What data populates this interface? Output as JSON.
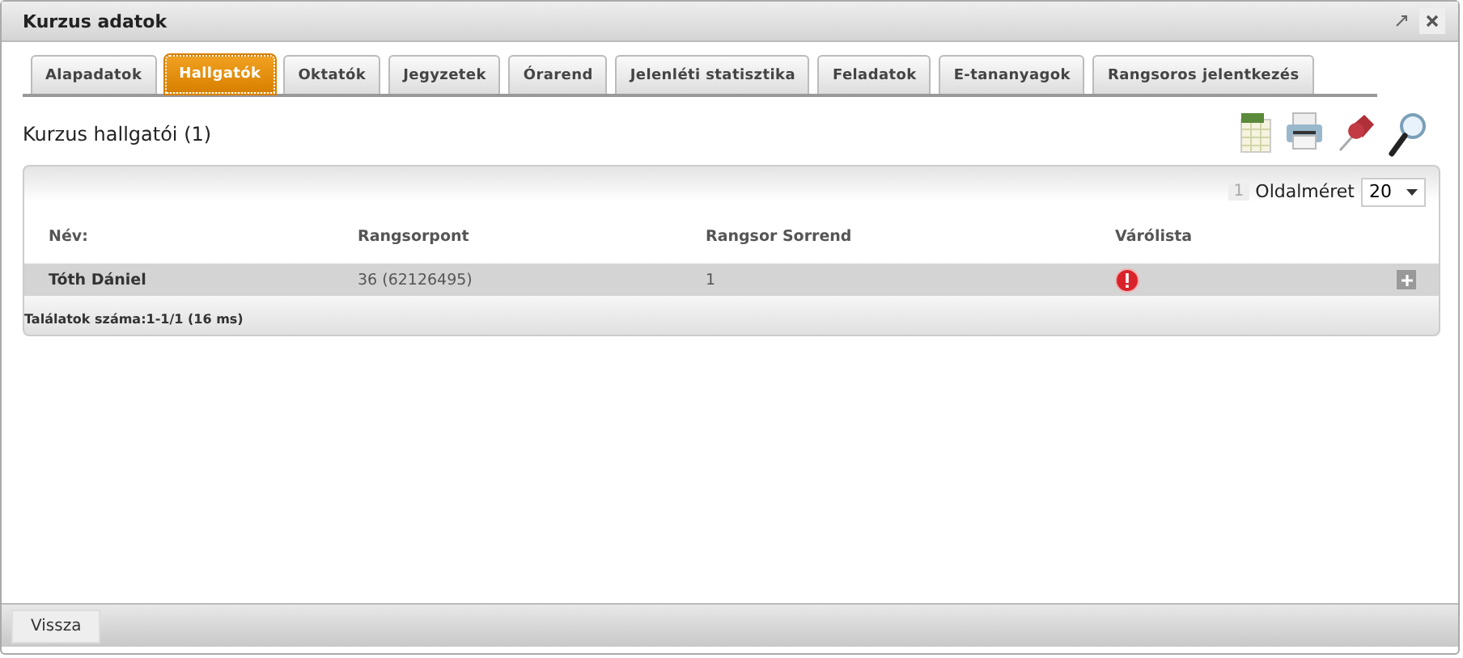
{
  "window": {
    "title": "Kurzus adatok"
  },
  "tabs": [
    {
      "label": "Alapadatok",
      "selected": false
    },
    {
      "label": "Hallgatók",
      "selected": true
    },
    {
      "label": "Oktatók",
      "selected": false
    },
    {
      "label": "Jegyzetek",
      "selected": false
    },
    {
      "label": "Órarend",
      "selected": false
    },
    {
      "label": "Jelenléti statisztika",
      "selected": false
    },
    {
      "label": "Feladatok",
      "selected": false
    },
    {
      "label": "E-tananyagok",
      "selected": false
    },
    {
      "label": "Rangsoros jelentkezés",
      "selected": false
    }
  ],
  "heading": "Kurzus hallgatói (1)",
  "pager": {
    "page": "1",
    "page_size_label": "Oldalméret",
    "page_size": "20"
  },
  "table": {
    "columns": [
      "Név:",
      "Rangsorpont",
      "Rangsor Sorrend",
      "Várólista"
    ],
    "rows": [
      {
        "name": "Tóth Dániel",
        "points": "36 (62126495)",
        "order": "1",
        "waitlist": true
      }
    ]
  },
  "result_count": "Találatok száma:1-1/1 (16 ms)",
  "footer": {
    "back_button": "Vissza"
  }
}
